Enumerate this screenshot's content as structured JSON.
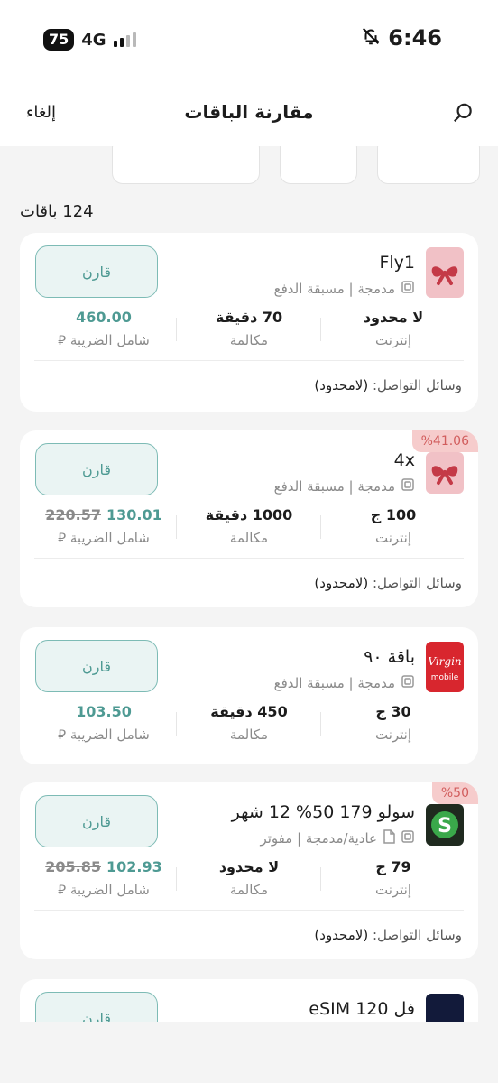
{
  "status_bar": {
    "time": "6:46",
    "battery": "75",
    "network": "4G"
  },
  "header": {
    "title": "مقارنة الباقات",
    "cancel_label": "إلغاء"
  },
  "results_count": "124 باقات",
  "labels": {
    "compare": "قارن",
    "internet": "إنترنت",
    "calls": "مكالمة",
    "tax_included": "شامل الضريبة",
    "social": "وسائل التواصل:",
    "currency": "⃁"
  },
  "plans": [
    {
      "name": "Fly1",
      "type": "مدمجة | مسبقة الدفع",
      "internet": "لا محدود",
      "calls": "70 دقيقة",
      "price": "460.00",
      "old_price": "",
      "social": "(لامحدود)",
      "discount": "",
      "brand_color": "#f1c1c6"
    },
    {
      "name": "4x",
      "type": "مدمجة | مسبقة الدفع",
      "internet": "100 ج",
      "calls": "1000 دقيقة",
      "price": "130.01",
      "old_price": "220.57",
      "social": "(لامحدود)",
      "discount": "%41.06",
      "brand_color": "#f1c1c6"
    },
    {
      "name": "باقة ٩٠",
      "type": "مدمجة | مسبقة الدفع",
      "internet": "30 ج",
      "calls": "450 دقيقة",
      "price": "103.50",
      "old_price": "",
      "social": "",
      "discount": "",
      "brand_color": "#d8262e"
    },
    {
      "name": "سولو 179 50% 12 شهر",
      "type": "عادية/مدمجة | مفوتر",
      "internet": "79 ج",
      "calls": "لا محدود",
      "price": "102.93",
      "old_price": "205.85",
      "social": "(لامحدود)",
      "discount": "%50",
      "brand_color": "#1f2a1f"
    },
    {
      "name": "فل 120 eSIM",
      "type": "",
      "internet": "",
      "calls": "",
      "price": "",
      "old_price": "",
      "social": "",
      "discount": "",
      "brand_color": "#121a3a"
    }
  ]
}
